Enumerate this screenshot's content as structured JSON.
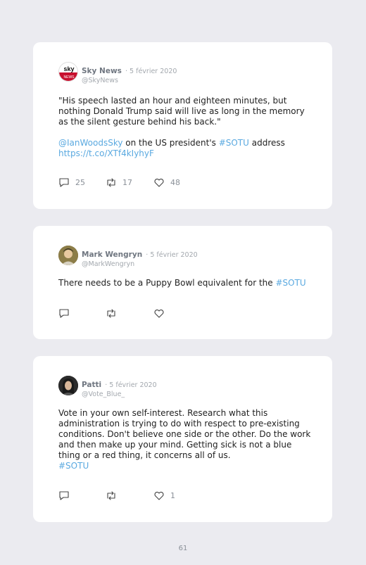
{
  "tweets": [
    {
      "name": "Sky News",
      "date": "5 février 2020",
      "handle": "@SkyNews",
      "text1": "\"His speech lasted an hour and eighteen minutes, but nothing Donald Trump said will live as long in the memory as the silent gesture behind his back.\"",
      "mention": "@IanWoodsSky",
      "text2": " on the US president's ",
      "hashtag": "#SOTU",
      "text3": " address",
      "url": "https://t.co/XTf4kIyhyF",
      "replies": "25",
      "retweets": "17",
      "likes": "48",
      "avatar_text": "sky news"
    },
    {
      "name": "Mark Wengryn",
      "date": "5 février 2020",
      "handle": "@MarkWengryn",
      "text1": "There needs to be a Puppy Bowl equivalent for the ",
      "hashtag": "#SOTU",
      "replies": "",
      "retweets": "",
      "likes": ""
    },
    {
      "name": "Patti",
      "date": "5 février 2020",
      "handle": "@Vote_Blue_",
      "text1": "Vote in your own self-interest. Research what this administration is trying to do with respect to pre-existing conditions. Don't believe one side or the other. Do the work and then make up your mind. Getting sick is not a blue thing or a red thing, it concerns all of us.",
      "hashtag": "#SOTU",
      "replies": "",
      "retweets": "",
      "likes": "1"
    }
  ],
  "page_number": "61",
  "colors": {
    "link": "#5aa9e0",
    "background": "#ebebf0",
    "card": "#ffffff"
  }
}
